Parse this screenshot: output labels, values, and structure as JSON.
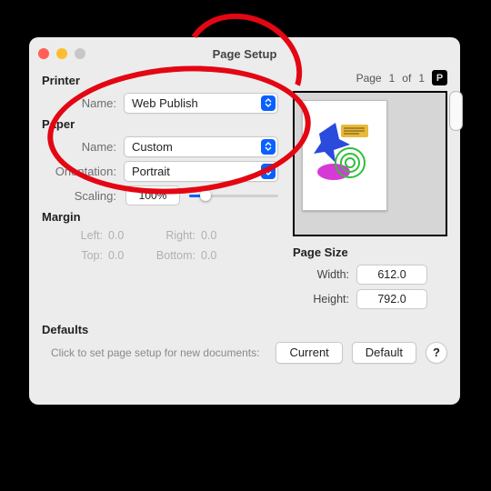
{
  "window": {
    "title": "Page Setup"
  },
  "sections": {
    "printer": "Printer",
    "paper": "Paper",
    "margin": "Margin",
    "pagesize": "Page Size",
    "defaults": "Defaults"
  },
  "labels": {
    "name": "Name:",
    "orientation": "Orientation:",
    "scaling": "Scaling:",
    "left": "Left:",
    "right": "Right:",
    "top": "Top:",
    "bottom": "Bottom:",
    "width": "Width:",
    "height": "Height:",
    "page": "Page",
    "of": "of"
  },
  "printer": {
    "name": "Web Publish"
  },
  "paper": {
    "name": "Custom",
    "orientation": "Portrait",
    "scaling": "100%"
  },
  "margin": {
    "left": "0.0",
    "right": "0.0",
    "top": "0.0",
    "bottom": "0.0"
  },
  "page": {
    "current": "1",
    "total": "1"
  },
  "pagesize": {
    "width": "612.0",
    "height": "792.0"
  },
  "defaults": {
    "hint": "Click to set page setup for new documents:",
    "current_btn": "Current",
    "default_btn": "Default",
    "help": "?"
  }
}
